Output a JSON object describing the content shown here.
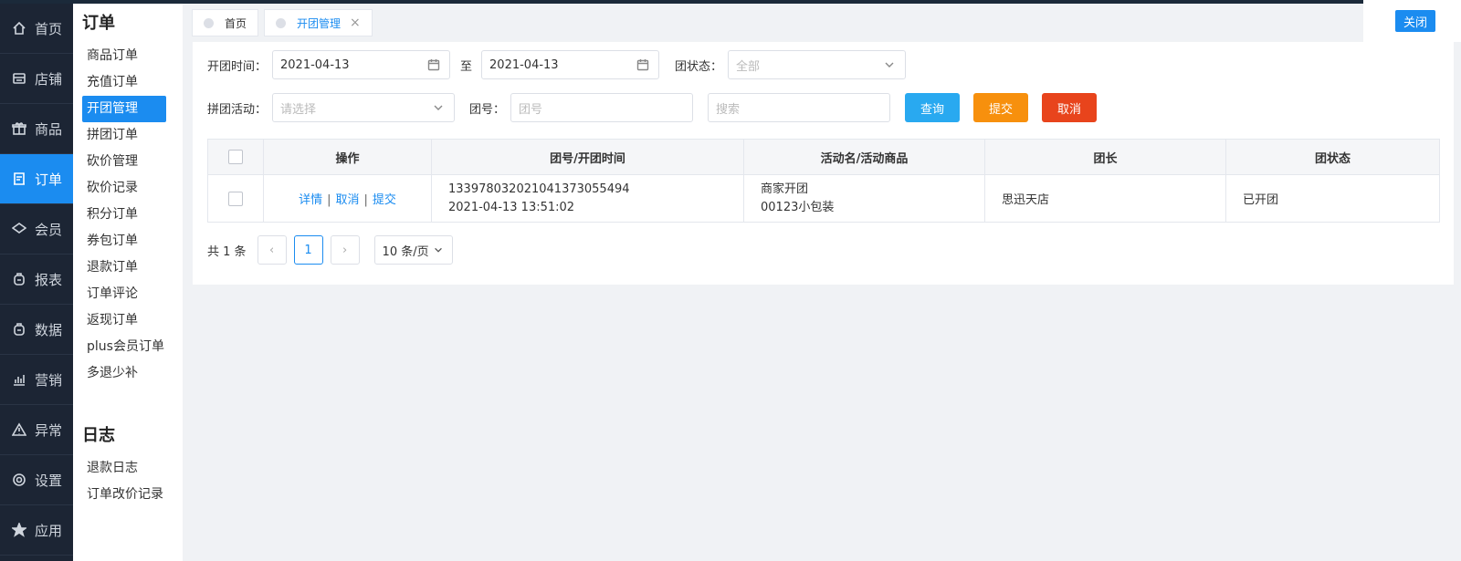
{
  "nav": {
    "items": [
      {
        "label": "首页",
        "icon": "home-icon"
      },
      {
        "label": "店铺",
        "icon": "store-icon"
      },
      {
        "label": "商品",
        "icon": "gift-icon"
      },
      {
        "label": "订单",
        "icon": "order-icon"
      },
      {
        "label": "会员",
        "icon": "member-icon"
      },
      {
        "label": "报表",
        "icon": "report-icon"
      },
      {
        "label": "数据",
        "icon": "data-icon"
      },
      {
        "label": "营销",
        "icon": "chart-icon"
      },
      {
        "label": "异常",
        "icon": "warning-icon"
      },
      {
        "label": "设置",
        "icon": "gear-icon"
      },
      {
        "label": "应用",
        "icon": "star-icon"
      }
    ],
    "active_index": 3
  },
  "submenu": {
    "order_title": "订单",
    "order_items": [
      "商品订单",
      "充值订单",
      "开团管理",
      "拼团订单",
      "砍价管理",
      "砍价记录",
      "积分订单",
      "券包订单",
      "退款订单",
      "订单评论",
      "返现订单",
      "plus会员订单",
      "多退少补"
    ],
    "active_item": "开团管理",
    "log_title": "日志",
    "log_items": [
      "退款日志",
      "订单改价记录"
    ]
  },
  "tabs": [
    {
      "label": "首页",
      "active": false
    },
    {
      "label": "开团管理",
      "active": true,
      "close": "×"
    }
  ],
  "close_button": "关闭",
  "filters": {
    "open_time_label": "开团时间：",
    "date_from": "2021-04-13",
    "to_label": "至",
    "date_to": "2021-04-13",
    "status_label": "团状态：",
    "status_value": "全部",
    "activity_label": "拼团活动：",
    "activity_placeholder": "请选择",
    "group_no_label": "团号：",
    "group_no_placeholder": "团号",
    "search_placeholder": "搜索",
    "query_button": "查询",
    "submit_button": "提交",
    "cancel_button": "取消"
  },
  "colors": {
    "primary": "#1b8cf0",
    "query": "#29a9f0",
    "submit": "#f7900d",
    "cancel": "#e8441c",
    "nav_bg": "#1c2534"
  },
  "table": {
    "headers": [
      "操作",
      "团号/开团时间",
      "活动名/活动商品",
      "团长",
      "团状态"
    ],
    "rows": [
      {
        "actions": [
          "详情",
          "取消",
          "提交"
        ],
        "group_no": "1339780320210413730554​94",
        "open_time": "2021-04-13 13:51:02",
        "activity_name": "商家开团",
        "activity_goods": "00123小包装",
        "leader": "思迅天店",
        "status": "已开团"
      }
    ]
  },
  "pager": {
    "total": "共 1 条",
    "prev": "‹",
    "current": "1",
    "next": "›",
    "page_size": "10 条/页"
  }
}
